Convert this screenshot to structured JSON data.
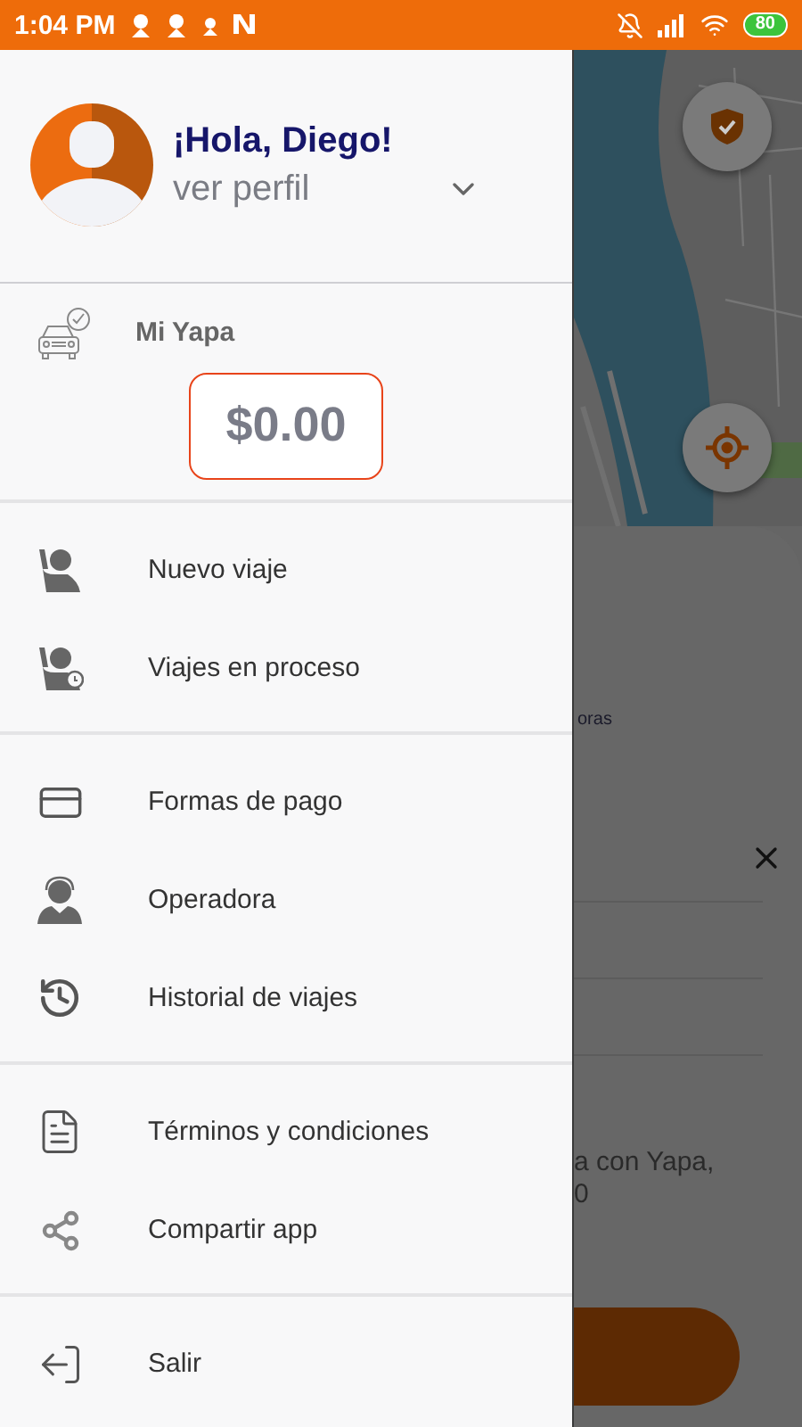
{
  "status_bar": {
    "time": "1:04 PM",
    "battery": "80"
  },
  "drawer": {
    "profile": {
      "greeting": "¡Hola, Diego!",
      "link": "ver perfil"
    },
    "wallet": {
      "title": "Mi Yapa",
      "balance": "$0.00"
    },
    "menu_groups": [
      [
        {
          "kind": "new-trip",
          "label": "Nuevo viaje"
        },
        {
          "kind": "trips-in-progress",
          "label": "Viajes en proceso"
        }
      ],
      [
        {
          "kind": "payment",
          "label": "Formas de pago"
        },
        {
          "kind": "operator",
          "label": "Operadora"
        },
        {
          "kind": "history",
          "label": "Historial de viajes"
        }
      ],
      [
        {
          "kind": "terms",
          "label": "Términos y condiciones"
        },
        {
          "kind": "share",
          "label": "Compartir app"
        }
      ],
      [
        {
          "kind": "logout",
          "label": "Salir"
        }
      ]
    ]
  },
  "background": {
    "option_label": "oras",
    "note_lines": [
      "a con Yapa,",
      "0"
    ]
  }
}
